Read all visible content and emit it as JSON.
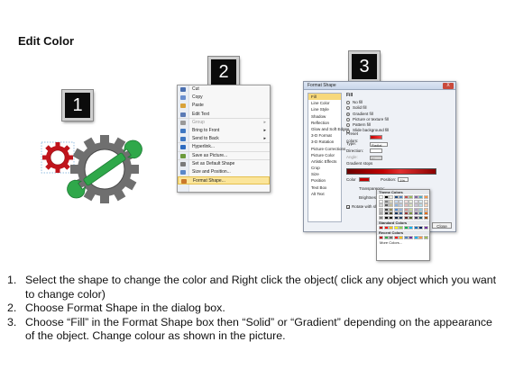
{
  "title": "Edit Color",
  "steps": [
    "1",
    "2",
    "3"
  ],
  "context_menu": {
    "items": [
      {
        "label": "Cut",
        "icon": "scissors-icon",
        "disabled": false,
        "sep": false,
        "arrow": false,
        "highlight": false
      },
      {
        "label": "Copy",
        "icon": "copy-icon",
        "disabled": false,
        "sep": false,
        "arrow": false,
        "highlight": false
      },
      {
        "label": "Paste",
        "icon": "paste-icon",
        "disabled": false,
        "sep": false,
        "arrow": false,
        "highlight": false
      },
      {
        "label": "Edit Text",
        "icon": "edit-text-icon",
        "disabled": false,
        "sep": true,
        "arrow": false,
        "highlight": false
      },
      {
        "label": "Group",
        "icon": "group-icon",
        "disabled": true,
        "sep": false,
        "arrow": true,
        "highlight": false
      },
      {
        "label": "Bring to Front",
        "icon": "bring-front-icon",
        "disabled": false,
        "sep": false,
        "arrow": true,
        "highlight": false
      },
      {
        "label": "Send to Back",
        "icon": "send-back-icon",
        "disabled": false,
        "sep": true,
        "arrow": true,
        "highlight": false
      },
      {
        "label": "Hyperlink...",
        "icon": "hyperlink-icon",
        "disabled": false,
        "sep": true,
        "arrow": false,
        "highlight": false
      },
      {
        "label": "Save as Picture...",
        "icon": "save-picture-icon",
        "disabled": false,
        "sep": true,
        "arrow": false,
        "highlight": false
      },
      {
        "label": "Set as Default Shape",
        "icon": "default-shape-icon",
        "disabled": false,
        "sep": false,
        "arrow": false,
        "highlight": false
      },
      {
        "label": "Size and Position...",
        "icon": "size-position-icon",
        "disabled": false,
        "sep": false,
        "arrow": false,
        "highlight": false
      },
      {
        "label": "Format Shape...",
        "icon": "format-shape-icon",
        "disabled": false,
        "sep": false,
        "arrow": false,
        "highlight": true
      }
    ]
  },
  "dialog": {
    "title": "Format Shape",
    "close": "X",
    "nav": [
      "Fill",
      "Line Color",
      "Line Style",
      "Shadow",
      "Reflection",
      "Glow and Soft Edges",
      "3-D Format",
      "3-D Rotation",
      "Picture Corrections",
      "Picture Color",
      "Artistic Effects",
      "Crop",
      "Size",
      "Position",
      "Text Box",
      "Alt Text"
    ],
    "fill_heading": "Fill",
    "fill_options": [
      {
        "label": "No fill",
        "on": false
      },
      {
        "label": "Solid fill",
        "on": false
      },
      {
        "label": "Gradient fill",
        "on": true
      },
      {
        "label": "Picture or texture fill",
        "on": false
      },
      {
        "label": "Pattern fill",
        "on": false
      },
      {
        "label": "Slide background fill",
        "on": false
      }
    ],
    "fields": [
      {
        "label": "Preset colors:"
      },
      {
        "label": "Type:",
        "value": "Radial"
      },
      {
        "label": "Direction:"
      },
      {
        "label": "Angle:",
        "value": "0°"
      }
    ],
    "gradient_stops_label": "Gradient stops",
    "color_label": "Color",
    "position_label": "Position:",
    "position_value": "1%",
    "transparency_label": "Transparency:",
    "brightness_label": "Brightness:",
    "rotate_label": "Rotate with shape",
    "close_button": "Close"
  },
  "picker": {
    "theme_label": "Theme Colors",
    "standard_label": "Standard Colors",
    "recent_label": "Recent Colors",
    "more_label": "More Colors..."
  },
  "instructions": [
    {
      "n": "1.",
      "text": "Select the shape to change the color and Right click the object( click any object which you want to change color)"
    },
    {
      "n": "2.",
      "text": "Choose Format Shape in the dialog box."
    },
    {
      "n": "3.",
      "text": "Choose “Fill” in the Format Shape box then “Solid” or “Gradient” depending on the appearance of the object. Change colour as shown in the picture."
    }
  ]
}
